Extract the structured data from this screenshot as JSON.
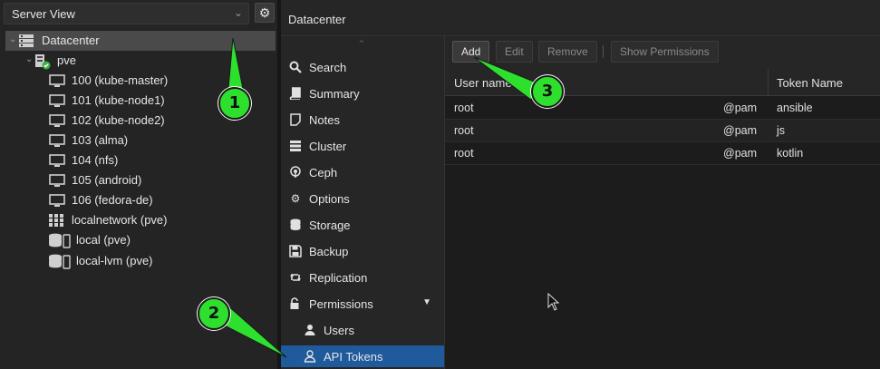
{
  "left_panel": {
    "view_select": "Server View",
    "tree": [
      {
        "label": "Datacenter",
        "icon": "datacenter-icon"
      },
      {
        "label": "pve",
        "icon": "node-online-icon"
      },
      {
        "label": "100 (kube-master)",
        "icon": "vm-icon"
      },
      {
        "label": "101 (kube-node1)",
        "icon": "vm-icon"
      },
      {
        "label": "102 (kube-node2)",
        "icon": "vm-icon"
      },
      {
        "label": "103 (alma)",
        "icon": "vm-icon"
      },
      {
        "label": "104 (nfs)",
        "icon": "vm-icon"
      },
      {
        "label": "105 (android)",
        "icon": "vm-icon"
      },
      {
        "label": "106 (fedora-de)",
        "icon": "vm-icon"
      },
      {
        "label": "localnetwork (pve)",
        "icon": "network-grid-icon"
      },
      {
        "label": "local (pve)",
        "icon": "storage-icon"
      },
      {
        "label": "local-lvm (pve)",
        "icon": "storage-icon"
      }
    ]
  },
  "header": {
    "title": "Datacenter"
  },
  "nav": {
    "items": [
      {
        "label": "Search",
        "icon": "search-icon"
      },
      {
        "label": "Summary",
        "icon": "book-icon"
      },
      {
        "label": "Notes",
        "icon": "notes-icon"
      },
      {
        "label": "Cluster",
        "icon": "server-icon"
      },
      {
        "label": "Ceph",
        "icon": "ceph-icon"
      },
      {
        "label": "Options",
        "icon": "gear-icon"
      },
      {
        "label": "Storage",
        "icon": "database-icon"
      },
      {
        "label": "Backup",
        "icon": "floppy-icon"
      },
      {
        "label": "Replication",
        "icon": "retweet-icon"
      },
      {
        "label": "Permissions",
        "icon": "unlock-icon"
      },
      {
        "label": "Users",
        "icon": "user-icon"
      },
      {
        "label": "API Tokens",
        "icon": "user-outline-icon"
      }
    ]
  },
  "toolbar": {
    "add": "Add",
    "edit": "Edit",
    "remove": "Remove",
    "show_permissions": "Show Permissions"
  },
  "grid": {
    "columns": [
      "User name",
      "Token Name"
    ],
    "rows": [
      {
        "user": "root",
        "realm": "@pam",
        "token": "ansible"
      },
      {
        "user": "root",
        "realm": "@pam",
        "token": "js"
      },
      {
        "user": "root",
        "realm": "@pam",
        "token": "kotlin"
      }
    ]
  },
  "callouts": [
    "1",
    "2",
    "3"
  ],
  "colors": {
    "callout": "#2ee02e",
    "active_nav": "#1e5a9c",
    "node_online": "#3cb043"
  }
}
